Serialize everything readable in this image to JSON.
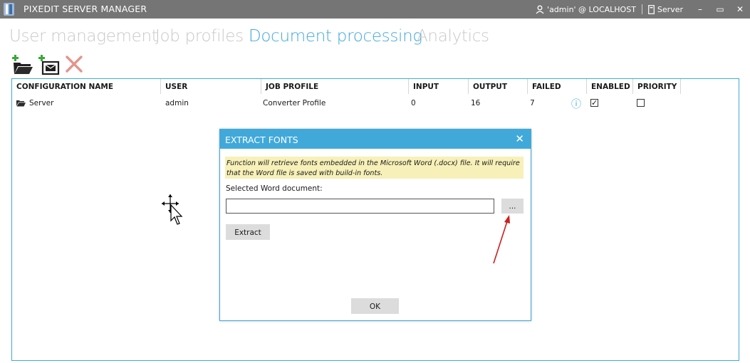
{
  "window": {
    "title": "PIXEDIT SERVER MANAGER",
    "user_label": "'admin' @ LOCALHOST",
    "server_label": "Server",
    "minimize": "–",
    "maximize": "▭",
    "close": "✕"
  },
  "tabs": [
    {
      "label": "User management",
      "active": false
    },
    {
      "label": "Job profiles",
      "active": false
    },
    {
      "label": "Document processing",
      "active": true
    },
    {
      "label": "Analytics",
      "active": false
    }
  ],
  "toolbar": {
    "icons": [
      "add-folder-icon",
      "add-mailbox-icon",
      "delete-icon"
    ]
  },
  "table": {
    "columns": [
      "CONFIGURATION NAME",
      "USER",
      "JOB PROFILE",
      "INPUT",
      "OUTPUT",
      "FAILED",
      "ENABLED",
      "PRIORITY"
    ],
    "rows": [
      {
        "name": "Server",
        "user": "admin",
        "job_profile": "Converter Profile",
        "input": "0",
        "output": "16",
        "failed": "7",
        "info_icon": "ⓘ",
        "enabled": true,
        "enabled_glyph": "✓",
        "priority": false
      }
    ]
  },
  "dialog": {
    "title": "EXTRACT FONTS",
    "close": "✕",
    "notice": "Function will retrieve fonts embedded in the Microsoft Word (.docx) file. It will require that the Word file is saved with build-in fonts.",
    "label": "Selected Word document:",
    "input_value": "",
    "browse_label": "...",
    "extract_label": "Extract",
    "ok_label": "OK"
  },
  "colors": {
    "accent": "#41a9da",
    "titlebar": "#757575",
    "notice_bg": "#f7f0b8",
    "annotation_arrow": "#cc1f1f"
  }
}
